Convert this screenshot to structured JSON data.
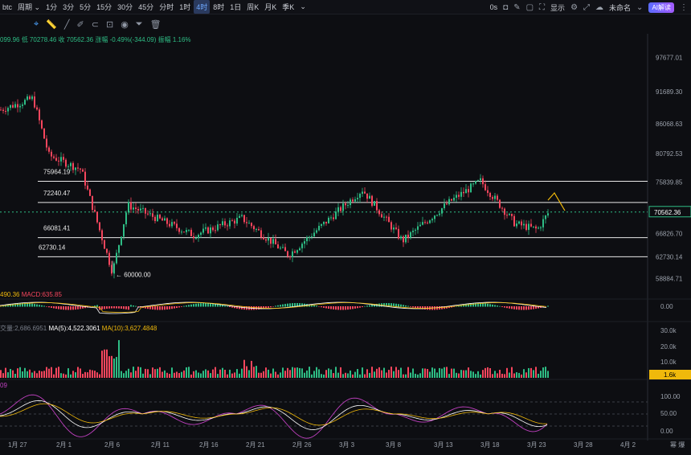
{
  "toolbar": {
    "symbol_fragment": "btc",
    "period_label": "周期",
    "timeframes": [
      "1分",
      "3分",
      "5分",
      "15分",
      "30分",
      "45分",
      "分时",
      "1时",
      "4时",
      "8时",
      "1日",
      "周K",
      "月K",
      "季K"
    ],
    "active_timeframe": "4时",
    "time_readout": "0s",
    "display_label": "显示",
    "layout_name": "未命名",
    "ai_label": "AI解读"
  },
  "info_line": {
    "open_partial": "099.96",
    "low": "低 70278.46",
    "close": "收 70562.36",
    "change": "涨幅 -0.49%(-344.09)",
    "amplitude": "振幅 1.16%"
  },
  "price_axis": [
    "97677.01",
    "91689.30",
    "86068.63",
    "80792.53",
    "75839.85",
    "70562.36",
    "66826.70",
    "62730.14",
    "58884.71"
  ],
  "current_price": "70562.36",
  "levels": [
    {
      "label": "75964.19",
      "price": 75964.19
    },
    {
      "label": "72240.47",
      "price": 72240.47
    },
    {
      "label": "66081.41",
      "price": 66081.41
    },
    {
      "label": "62730.14",
      "price": 62730.14
    }
  ],
  "low_marker": "60000.00",
  "macd": {
    "dif_fragment": "490.36",
    "macd_label": "MACD:635.85",
    "axis_zero": "0.00"
  },
  "volume": {
    "vol_fragment": "交量:2,686.6951",
    "ma5": "MA(5):4,522.3061",
    "ma10": "MA(10):3,627.4848",
    "axis": [
      "30.0k",
      "20.0k",
      "10.0k"
    ],
    "current": "1.6k"
  },
  "kdj": {
    "fragment": "09",
    "axis": [
      "100.00",
      "50.00",
      "0.00"
    ]
  },
  "x_axis": [
    "1月 27",
    "2月 1",
    "2月 6",
    "2月 11",
    "2月 16",
    "2月 21",
    "2月 26",
    "3月 3",
    "3月 8",
    "3月 13",
    "3月 18",
    "3月 23",
    "3月 28",
    "4月 2"
  ],
  "x_axis_right": "幂 爆",
  "chart_data": {
    "type": "candlestick",
    "title": "",
    "ylim": [
      57000,
      99000
    ],
    "key_prices": [
      {
        "name": "start",
        "value": 88500
      },
      {
        "name": "peak_jan29",
        "value": 90500
      },
      {
        "name": "low_feb6",
        "value": 60000
      },
      {
        "name": "rebound_feb8",
        "value": 71800
      },
      {
        "name": "low_feb26",
        "value": 63000
      },
      {
        "name": "high_mar4",
        "value": 74500
      },
      {
        "name": "low_mar8",
        "value": 65500
      },
      {
        "name": "high_mar17",
        "value": 76000
      },
      {
        "name": "last",
        "value": 70562.36
      }
    ]
  },
  "colors": {
    "up": "#2ebd85",
    "down": "#f6465d",
    "accent": "#f0b90b",
    "macd_dif": "#ffffff",
    "kdj_j": "#c040c0"
  }
}
